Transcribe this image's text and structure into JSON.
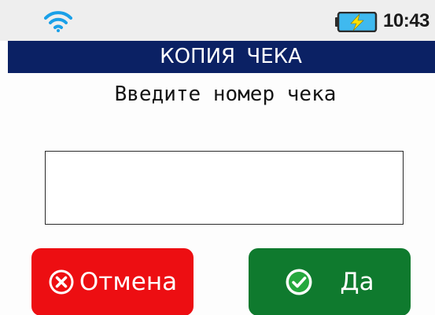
{
  "status_bar": {
    "time": "10:43",
    "wifi_icon": "wifi-icon",
    "battery_icon": "battery-charging-icon",
    "battery_color": "#3fb9ef",
    "bolt_color": "#ffe100"
  },
  "title_bar": {
    "title": "КОПИЯ ЧЕКА",
    "background_color": "#0b2164"
  },
  "prompt": {
    "text": "Введите номер чека"
  },
  "receipt_number_input": {
    "value": ""
  },
  "buttons": {
    "cancel": {
      "label": "Отмена",
      "icon": "x-circle-icon",
      "color": "#ed0e12"
    },
    "ok": {
      "label": "Да",
      "icon": "check-circle-icon",
      "color": "#0f7a2e"
    }
  }
}
